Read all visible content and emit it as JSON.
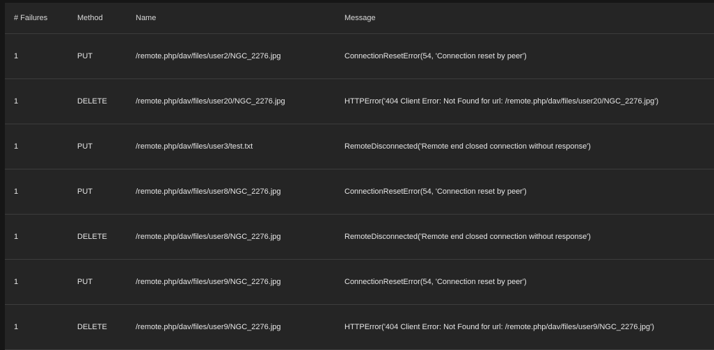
{
  "table": {
    "headers": {
      "failures": "# Failures",
      "method": "Method",
      "name": "Name",
      "message": "Message"
    },
    "rows": [
      {
        "failures": "1",
        "method": "PUT",
        "name": "/remote.php/dav/files/user2/NGC_2276.jpg",
        "message": "ConnectionResetError(54, 'Connection reset by peer')"
      },
      {
        "failures": "1",
        "method": "DELETE",
        "name": "/remote.php/dav/files/user20/NGC_2276.jpg",
        "message": "HTTPError('404 Client Error: Not Found for url: /remote.php/dav/files/user20/NGC_2276.jpg')"
      },
      {
        "failures": "1",
        "method": "PUT",
        "name": "/remote.php/dav/files/user3/test.txt",
        "message": "RemoteDisconnected('Remote end closed connection without response')"
      },
      {
        "failures": "1",
        "method": "PUT",
        "name": "/remote.php/dav/files/user8/NGC_2276.jpg",
        "message": "ConnectionResetError(54, 'Connection reset by peer')"
      },
      {
        "failures": "1",
        "method": "DELETE",
        "name": "/remote.php/dav/files/user8/NGC_2276.jpg",
        "message": "RemoteDisconnected('Remote end closed connection without response')"
      },
      {
        "failures": "1",
        "method": "PUT",
        "name": "/remote.php/dav/files/user9/NGC_2276.jpg",
        "message": "ConnectionResetError(54, 'Connection reset by peer')"
      },
      {
        "failures": "1",
        "method": "DELETE",
        "name": "/remote.php/dav/files/user9/NGC_2276.jpg",
        "message": "HTTPError('404 Client Error: Not Found for url: /remote.php/dav/files/user9/NGC_2276.jpg')"
      }
    ]
  }
}
